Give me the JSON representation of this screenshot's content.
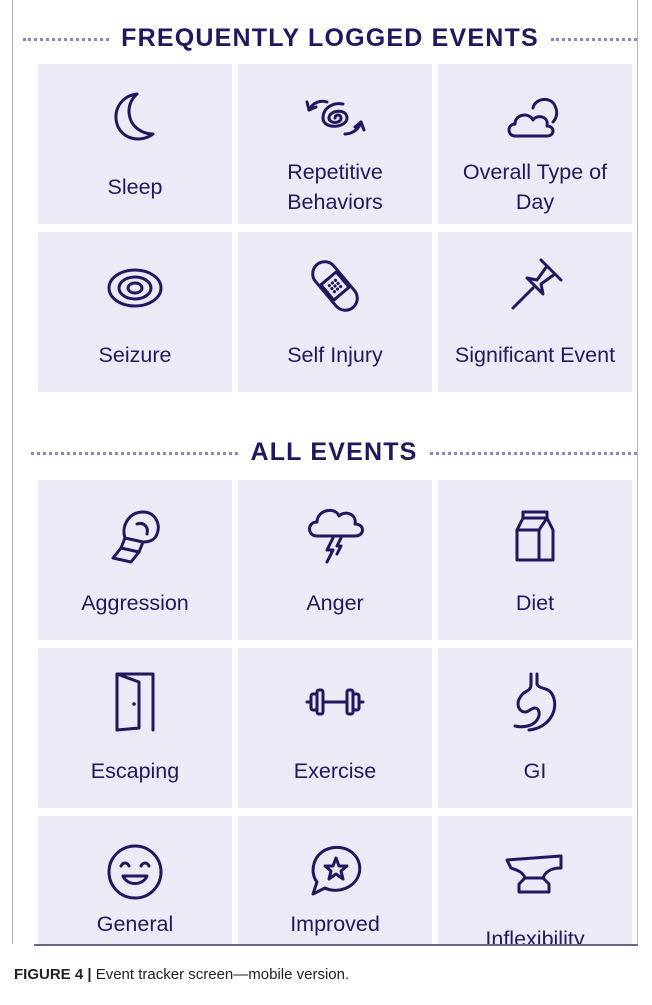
{
  "frequent": {
    "title": "FREQUENTLY LOGGED EVENTS",
    "tiles": [
      {
        "label": "Sleep",
        "icon": "moon-icon"
      },
      {
        "label": "Repetitive Behaviors",
        "icon": "spiral-arrows-icon"
      },
      {
        "label": "Overall Type of Day",
        "icon": "cloud-sun-icon"
      },
      {
        "label": "Seizure",
        "icon": "concentric-rings-icon"
      },
      {
        "label": "Self Injury",
        "icon": "bandage-icon"
      },
      {
        "label": "Significant Event",
        "icon": "pushpin-icon"
      }
    ]
  },
  "all": {
    "title": "ALL EVENTS",
    "tiles": [
      {
        "label": "Aggression",
        "icon": "boxing-glove-icon"
      },
      {
        "label": "Anger",
        "icon": "storm-cloud-icon"
      },
      {
        "label": "Diet",
        "icon": "milk-carton-icon"
      },
      {
        "label": "Escaping",
        "icon": "open-door-icon"
      },
      {
        "label": "Exercise",
        "icon": "dumbbell-icon"
      },
      {
        "label": "GI",
        "icon": "stomach-icon"
      },
      {
        "label": "General Happiness",
        "icon": "smiley-icon"
      },
      {
        "label": "Improved Language",
        "icon": "speech-bubble-star-icon"
      },
      {
        "label": "Inflexibility",
        "icon": "anvil-icon"
      }
    ]
  },
  "caption": {
    "label": "FIGURE 4 |",
    "text": " Event tracker screen—mobile version."
  },
  "colors": {
    "accent": "#22175e",
    "tile": "#eceaf7",
    "dots": "#8f87c0"
  }
}
